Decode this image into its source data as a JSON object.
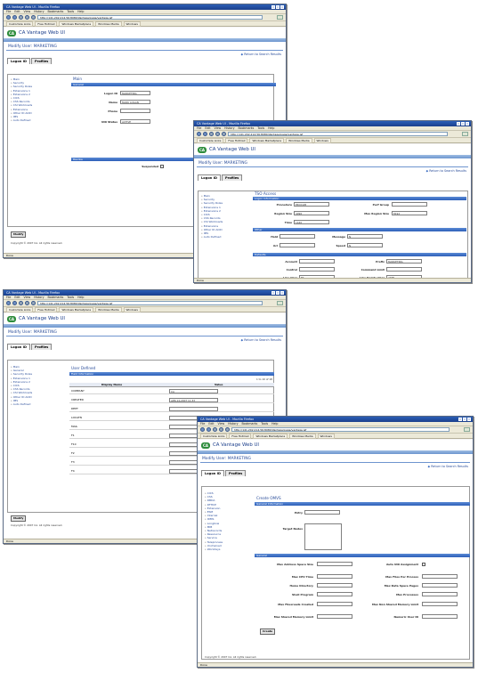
{
  "browser": {
    "title": "CA Vantage Web UI - Mozilla Firefox",
    "menu": [
      "File",
      "Edit",
      "View",
      "History",
      "Bookmarks",
      "Tools",
      "Help"
    ],
    "url": "http://141.202.214.56:8080/Vantage/page/vantage.jsf",
    "bookmarks": [
      "Customize Links",
      "Free Hotmail",
      "Windows Marketplace",
      "Windows Media",
      "Windows"
    ],
    "status": "Done"
  },
  "app": {
    "logo": "CA",
    "title": "CA Vantage Web UI",
    "page_title": "Modify User: MARKETING",
    "return_link": "Return to Search Results",
    "tabs": [
      "Logon ID",
      "Profiles"
    ],
    "copyright": "Copyright © 2007 CA. All rights reserved.",
    "modify_button": "Modify"
  },
  "win1": {
    "nav": [
      "Main",
      "Security",
      "Security Roles",
      "Extensions 1",
      "Extensions 2",
      "CICS",
      "CSS Records",
      "CSI Workloads",
      "Extensions",
      "Other ID ACID",
      "IMS",
      "Auto Defined"
    ],
    "section": "Main",
    "bar": "General",
    "fields": [
      {
        "label": "Logon ID",
        "value": "MARKETING"
      },
      {
        "label": "Name",
        "value": "MARK LOGAN"
      },
      {
        "label": "Phone",
        "value": ""
      },
      {
        "label": "UID Status",
        "value": "ACTIVE"
      }
    ],
    "bar2": "Revoke",
    "suspended_label": "Suspended"
  },
  "win2": {
    "section": "TSO Access",
    "bar1": "Logon Information",
    "fields1": [
      {
        "label": "Procedure",
        "value": "PROCLIB"
      },
      {
        "label": "Region Size",
        "value": "4096"
      },
      {
        "label": "Time",
        "value": "1440"
      },
      {
        "label": "Perf Group",
        "value": ""
      },
      {
        "label": "Max Region Size",
        "value": "8192"
      }
    ],
    "bar2": "Other",
    "fields2": [
      {
        "label": "Hold",
        "value": ""
      },
      {
        "label": "Acl",
        "value": ""
      },
      {
        "label": "Message",
        "value": "N"
      },
      {
        "label": "Speed",
        "value": "N"
      }
    ],
    "bar3": "Defaults",
    "fields3": [
      {
        "label": "Account",
        "value": ""
      },
      {
        "label": "Control",
        "value": ""
      },
      {
        "label": "Line Char",
        "value": "BS"
      },
      {
        "label": "Dest",
        "value": ""
      },
      {
        "label": "Size",
        "value": ""
      },
      {
        "label": "Prefix",
        "value": "MARKETING"
      },
      {
        "label": "Command Limit",
        "value": ""
      },
      {
        "label": "Line Delete Char",
        "value": "ATTN"
      },
      {
        "label": "Allocation Unit",
        "value": ""
      }
    ]
  },
  "win3": {
    "nav": [
      "Main",
      "General",
      "Security Roles",
      "Extensions 1",
      "Extensions 2",
      "CICS",
      "CSS Records",
      "CSI Workloads",
      "Other ID ACID",
      "IMS",
      "Auto Defined"
    ],
    "section": "User Defined",
    "bar": "Field Information",
    "count": "1 to 10 of 18",
    "columns": [
      "Display Name",
      "Value"
    ],
    "rows": [
      {
        "name": "COMPANY",
        "value": "CA"
      },
      {
        "name": "CREATED",
        "value": "APR-14-2007 11:33"
      },
      {
        "name": "DEPT",
        "value": ""
      },
      {
        "name": "LOCATN",
        "value": ""
      },
      {
        "name": "MAIL",
        "value": ""
      },
      {
        "name": "F1",
        "value": ""
      },
      {
        "name": "F10",
        "value": ""
      },
      {
        "name": "F2",
        "value": ""
      },
      {
        "name": "F3",
        "value": ""
      },
      {
        "name": "F4",
        "value": ""
      }
    ]
  },
  "win4": {
    "nav": [
      "CICS",
      "CSS",
      "DBDA",
      "DFHCP",
      "Extension",
      "ESM",
      "Internal",
      "IDMS",
      "Longbow",
      "MIB",
      "Netrecords",
      "Ressource",
      "Service",
      "Teleprocess",
      "Unchained",
      "Workdays"
    ],
    "section": "Create OMVS",
    "bar1": "General Information",
    "fields1": [
      {
        "label": "Entry",
        "value": ""
      },
      {
        "label": "Target Nodes",
        "value": ""
      }
    ],
    "bar2": "General",
    "left_fields": [
      "Max Address Space Size",
      "Max CPU Time",
      "Home Directory",
      "Shell Program",
      "Max Filesreads Created",
      "Max Shared Memory Limit"
    ],
    "right_fields": [
      "Auto UID Assignment",
      "Max Files Per Process",
      "Max Data Space Pages",
      "Max Processes",
      "Max Non Shared Memory Limit",
      "Numeric User ID"
    ],
    "create_button": "Create"
  }
}
